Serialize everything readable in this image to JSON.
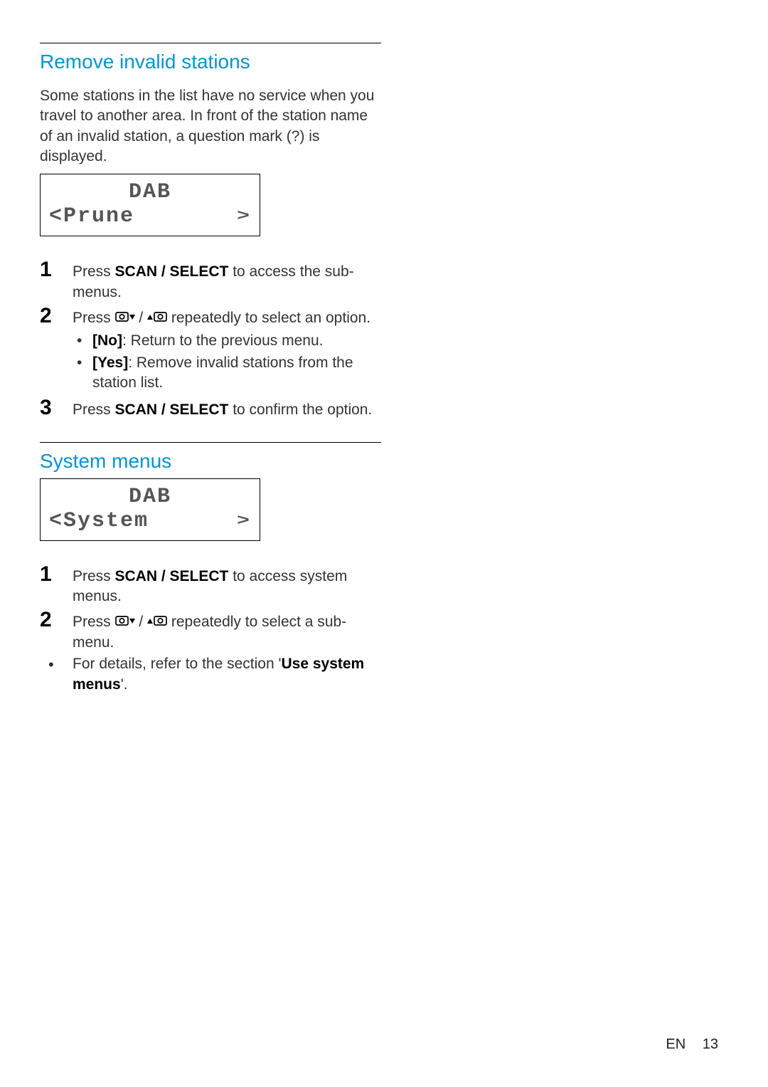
{
  "section1": {
    "heading": "Remove invalid stations",
    "intro": "Some stations in the list have no service when you travel to another area. In front of the station name of an invalid station, a question mark (?) is displayed.",
    "lcd": {
      "line1": "DAB",
      "line2": "<Prune",
      "arrow": ">"
    },
    "steps": {
      "n1": "1",
      "s1a": "Press ",
      "s1key": "SCAN / SELECT",
      "s1b": " to access the sub-menus.",
      "n2": "2",
      "s2a": "Press ",
      "s2b": " / ",
      "s2c": " repeatedly to select an option.",
      "opt1key": "[No]",
      "opt1text": ": Return to the previous menu.",
      "opt2key": "[Yes]",
      "opt2text": ": Remove invalid stations from the station list.",
      "n3": "3",
      "s3a": "Press ",
      "s3key": "SCAN / SELECT",
      "s3b": " to confirm the option."
    }
  },
  "section2": {
    "heading": "System menus",
    "lcd": {
      "line1": "DAB",
      "line2": "<System",
      "arrow": ">"
    },
    "steps": {
      "n1": "1",
      "s1a": "Press ",
      "s1key": "SCAN / SELECT",
      "s1b": " to access system menus.",
      "n2": "2",
      "s2a": "Press ",
      "s2b": " / ",
      "s2c": " repeatedly to select a sub-menu."
    },
    "note_a": "For details, refer to the section '",
    "note_bold": "Use system menus",
    "note_b": "'."
  },
  "footer": {
    "lang": "EN",
    "page": "13"
  }
}
